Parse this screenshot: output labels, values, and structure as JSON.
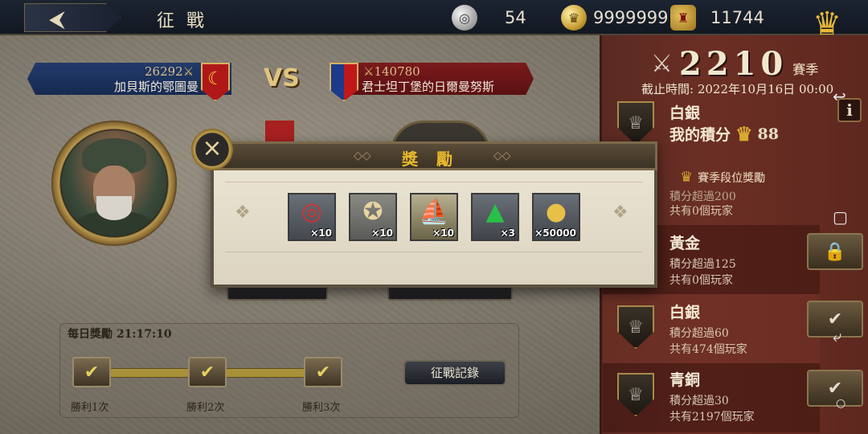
{
  "topbar": {
    "title": "征 戰",
    "silver_value": "54",
    "gold_value": "9999999",
    "crown_value": "11744"
  },
  "match": {
    "left_team": {
      "score": "26292",
      "name": "加貝斯的鄂圖曼"
    },
    "vs_label": "VS",
    "right_team": {
      "score": "140780",
      "name": "君士坦丁堡的日爾曼努斯"
    }
  },
  "season": {
    "score": "2210",
    "season_label": "賽季",
    "deadline": "截止時間: 2022年10月16日 00:00",
    "current_rank": "白銀",
    "my_points_label": "我的積分",
    "my_points": "88",
    "rewards_header": "賽季段位獎勵",
    "tiers": [
      {
        "name": "",
        "line1": "積分超過200",
        "line2": "共有0個玩家"
      },
      {
        "name": "黃金",
        "line1": "積分超過125",
        "line2": "共有0個玩家"
      },
      {
        "name": "白銀",
        "line1": "積分超過60",
        "line2": "共有474個玩家"
      },
      {
        "name": "青銅",
        "line1": "積分超過30",
        "line2": "共有2197個玩家"
      }
    ]
  },
  "daily": {
    "title": "每日獎勵 21:17:10",
    "milestones": [
      "勝利1次",
      "勝利2次",
      "勝利3次"
    ],
    "record_button": "征戰記錄"
  },
  "dialog": {
    "title": "獎 勵",
    "close_icon": "×",
    "items": [
      {
        "icon": "archery-target-icon",
        "qty": "×10"
      },
      {
        "icon": "treasure-map-icon",
        "qty": "×10"
      },
      {
        "icon": "ship-puzzle-icon",
        "qty": "×10"
      },
      {
        "icon": "emerald-gem-icon",
        "qty": "×3"
      },
      {
        "icon": "gold-coins-icon",
        "qty": "×50000"
      }
    ]
  },
  "colors": {
    "panel_red": "#6b2e24",
    "gold_text": "#e8b82c",
    "topbar": "#1c2432"
  }
}
